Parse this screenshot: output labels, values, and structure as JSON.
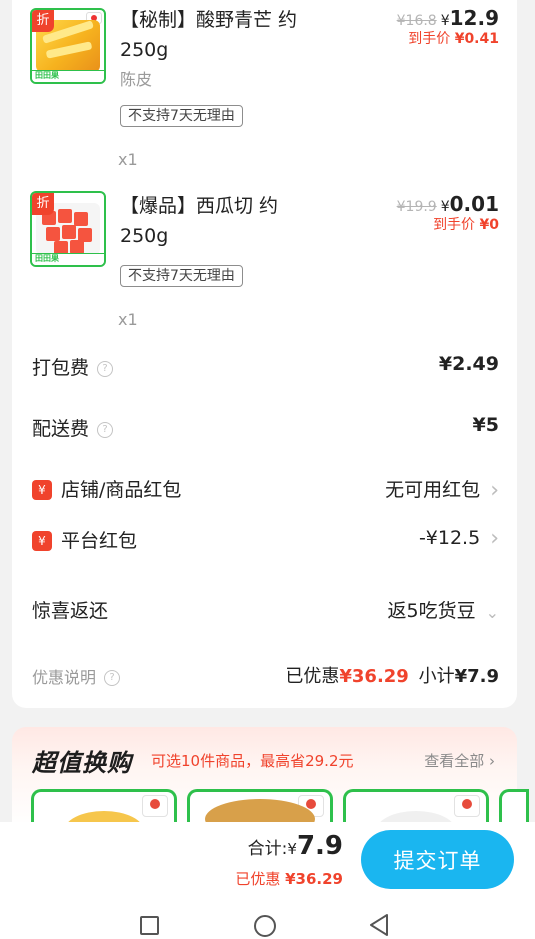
{
  "products": [
    {
      "discount_tag": "折",
      "name": "【秘制】酸野青芒 约250g",
      "spec": "陈皮",
      "policy": "不支持7天无理由",
      "qty": "x1",
      "orig_price": "¥16.8",
      "currency": "¥",
      "price": "12.9",
      "arrive_label": "到手价",
      "arrive_price": "¥0.41",
      "thumb_strip": "田田果"
    },
    {
      "discount_tag": "折",
      "name": "【爆品】西瓜切 约250g",
      "spec": "",
      "policy": "不支持7天无理由",
      "qty": "x1",
      "orig_price": "¥19.9",
      "currency": "¥",
      "price": "0.01",
      "arrive_label": "到手价",
      "arrive_price": "¥0",
      "thumb_strip": "田田果"
    }
  ],
  "fees": {
    "packing_label": "打包费",
    "packing_value": "¥2.49",
    "delivery_label": "配送费",
    "delivery_value": "¥5"
  },
  "coupons": {
    "badge": "¥",
    "shop_label": "店铺/商品红包",
    "shop_value": "无可用红包",
    "platform_label": "平台红包",
    "platform_value": "-¥12.5"
  },
  "surprise": {
    "label": "惊喜返还",
    "value": "返5吃货豆"
  },
  "summary": {
    "note_label": "优惠说明",
    "saved_label": "已优惠",
    "saved_value": "¥36.29",
    "subtotal_label": "小计",
    "subtotal_value": "¥7.9"
  },
  "promo": {
    "title": "超值换购",
    "subtitle": "可选10件商品，最高省29.2元",
    "view_all": "查看全部"
  },
  "bottom": {
    "total_label": "合计:",
    "currency": "¥",
    "total_value": "7.9",
    "saved_label": "已优惠",
    "saved_value": "¥36.29",
    "submit": "提交订单"
  },
  "colors": {
    "accent_red": "#f0432c",
    "submit_blue": "#1ab6f0",
    "frame_green": "#2ec04b"
  },
  "icons": {
    "help": "question-circle-icon",
    "chevron": "chevron-right-icon",
    "expand": "chevron-down-icon",
    "nav": [
      "square-recents-icon",
      "circle-home-icon",
      "triangle-back-icon"
    ]
  }
}
